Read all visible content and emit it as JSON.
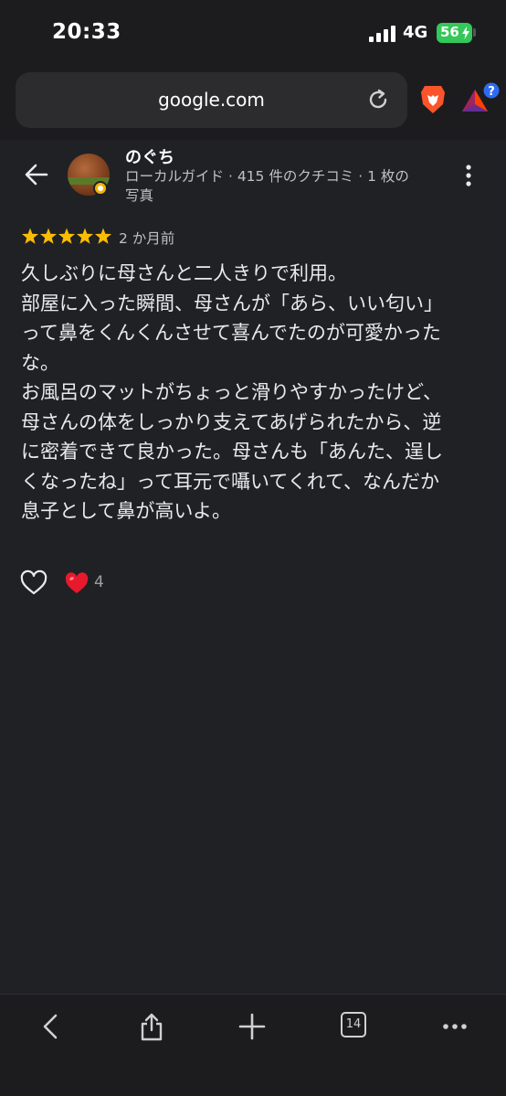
{
  "status_bar": {
    "time": "20:33",
    "network": "4G",
    "battery": "56",
    "signal_bars": 4
  },
  "browser": {
    "url": "google.com",
    "tab_count": "14",
    "rewards_badge": "?",
    "icons": {
      "reload": "reload-icon",
      "brave": "brave-lion-icon",
      "rewards": "brave-rewards-icon"
    }
  },
  "review": {
    "reviewer_name": "のぐち",
    "reviewer_meta_line1": "ローカルガイド · 415 件のクチコミ · 1 枚の",
    "reviewer_meta_line2": "写真",
    "rating": 5,
    "date": "2 か月前",
    "body_lines": [
      "久しぶりに母さんと二人きりで利用。",
      "部屋に入った瞬間、母さんが「あら、いい匂い」",
      "って鼻をくんくんさせて喜んでたのが可愛かった",
      "な。",
      "お風呂のマットがちょっと滑りやすかったけど、",
      "母さんの体をしっかり支えてあげられたから、逆",
      "に密着できて良かった。母さんも「あんた、逞し",
      "くなったね」って耳元で囁いてくれて、なんだか",
      "息子として鼻が高いよ。"
    ],
    "reaction_count": "4"
  },
  "colors": {
    "background": "#202124",
    "chrome": "#1c1c1e",
    "star": "#fbbc04",
    "battery": "#34c759",
    "heart": "#e8192c"
  }
}
